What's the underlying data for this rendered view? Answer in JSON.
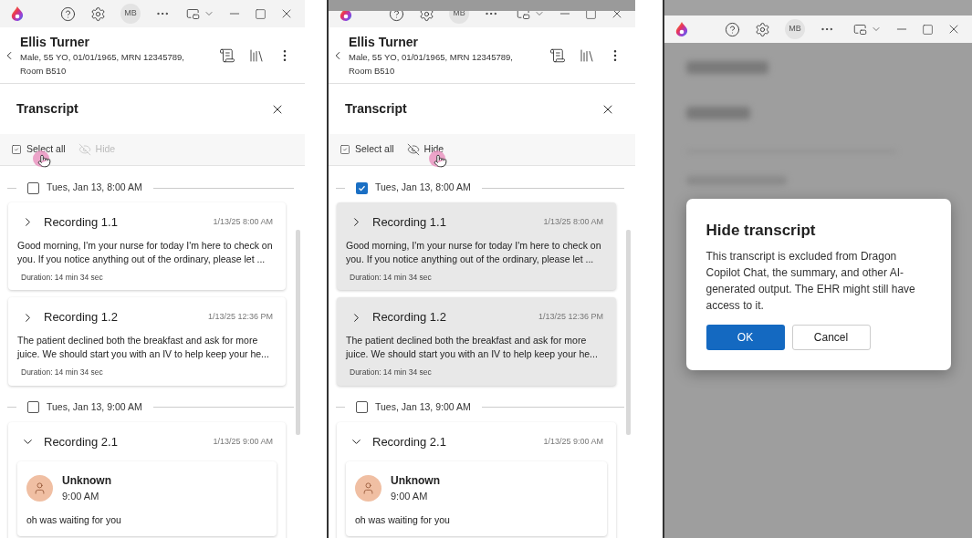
{
  "panels": [
    {
      "kind": "transcript",
      "dimmed_top": false,
      "titlebar": {
        "avatar": "MB"
      },
      "patient": {
        "name": "Ellis Turner",
        "details": "Male, 55 YO, 01/01/1965, MRN 12345789, Room B510"
      },
      "transcript": {
        "title": "Transcript",
        "toolbar": [
          {
            "label": "Select all",
            "disabled": false,
            "hovered": true
          },
          {
            "label": "Hide",
            "disabled": true,
            "hovered": false
          }
        ],
        "groups": [
          {
            "date": "Tues, Jan 13, 8:00 AM",
            "checked": false,
            "recordings": [
              {
                "title": "Recording 1.1",
                "time": "1/13/25 8:00 AM",
                "expanded": false,
                "selected": false,
                "excerpt": "Good morning, I'm your nurse for today I'm here to check on you. If you notice anything out of the ordinary, please let ...",
                "duration": "Duration: 14 min 34 sec"
              },
              {
                "title": "Recording 1.2",
                "time": "1/13/25 12:36 PM",
                "expanded": false,
                "selected": false,
                "excerpt": "The patient declined both the breakfast and ask for more juice. We should start you with an IV to help keep your he...",
                "duration": "Duration: 14 min 34 sec"
              }
            ]
          },
          {
            "date": "Tues, Jan 13, 9:00 AM",
            "checked": false,
            "recordings": [
              {
                "title": "Recording 2.1",
                "time": "1/13/25 9:00 AM",
                "expanded": true,
                "selected": false,
                "utterances": [
                  {
                    "speaker": "Unknown",
                    "time": "9:00 AM",
                    "text": "oh was waiting for you"
                  }
                ]
              }
            ]
          }
        ]
      }
    },
    {
      "kind": "transcript",
      "dimmed_top": true,
      "titlebar": {
        "avatar": "MB"
      },
      "patient": {
        "name": "Ellis Turner",
        "details": "Male, 55 YO, 01/01/1965, MRN 12345789, Room B510"
      },
      "transcript": {
        "title": "Transcript",
        "toolbar": [
          {
            "label": "Select all",
            "disabled": false,
            "hovered": false
          },
          {
            "label": "Hide",
            "disabled": false,
            "hovered": true
          }
        ],
        "groups": [
          {
            "date": "Tues, Jan 13, 8:00 AM",
            "checked": true,
            "recordings": [
              {
                "title": "Recording 1.1",
                "time": "1/13/25 8:00 AM",
                "expanded": false,
                "selected": true,
                "excerpt": "Good morning, I'm your nurse for today I'm here to check on you. If you notice anything out of the ordinary, please let ...",
                "duration": "Duration: 14 min 34 sec"
              },
              {
                "title": "Recording 1.2",
                "time": "1/13/25 12:36 PM",
                "expanded": false,
                "selected": true,
                "excerpt": "The patient declined both the breakfast and ask for more juice. We should start you with an IV to help keep your he...",
                "duration": "Duration: 14 min 34 sec"
              }
            ]
          },
          {
            "date": "Tues, Jan 13, 9:00 AM",
            "checked": false,
            "recordings": [
              {
                "title": "Recording 2.1",
                "time": "1/13/25 9:00 AM",
                "expanded": true,
                "selected": false,
                "utterances": [
                  {
                    "speaker": "Unknown",
                    "time": "9:00 AM",
                    "text": "oh was waiting for you"
                  }
                ]
              }
            ]
          }
        ]
      }
    },
    {
      "kind": "dialog",
      "titlebar": {
        "avatar": "MB"
      },
      "dialog": {
        "title": "Hide transcript",
        "body": "This transcript is excluded from Dragon Copilot Chat, the summary, and other AI-generated output. The EHR might still have access to it.",
        "buttons": [
          {
            "label": "OK",
            "primary": true
          },
          {
            "label": "Cancel",
            "primary": false
          }
        ]
      }
    }
  ]
}
